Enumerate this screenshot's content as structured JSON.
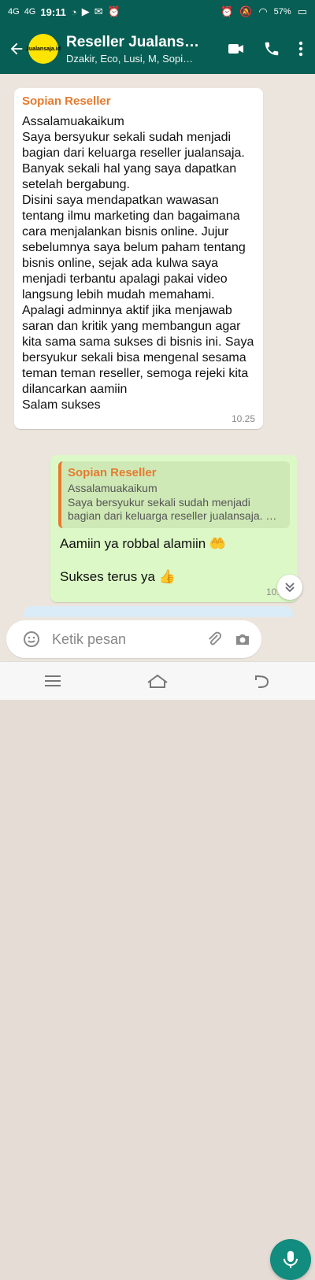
{
  "status": {
    "time": "19:11",
    "network1": "4G",
    "network2": "4G",
    "battery": "57%"
  },
  "chat": {
    "title": "Reseller Jualans…",
    "subtitle": "Dzakir, Eco, Lusi, M, Sopi…",
    "avatar_text": "Jualansaja.id"
  },
  "messages": {
    "incoming": {
      "sender": "Sopian Reseller",
      "text": "Assalamuakaikum\nSaya bersyukur sekali sudah menjadi bagian dari keluarga reseller jualansaja. Banyak sekali hal yang saya dapatkan setelah bergabung.\nDisini saya mendapatkan wawasan tentang ilmu marketing dan bagaimana cara menjalankan bisnis online. Jujur sebelumnya saya belum paham tentang bisnis online, sejak ada kulwa saya menjadi terbantu apalagi pakai video langsung lebih mudah memahami. Apalagi adminnya aktif jika menjawab saran dan kritik yang membangun agar kita sama sama sukses di bisnis ini. Saya bersyukur sekali bisa mengenal sesama teman teman reseller, semoga rejeki kita dilancarkan aamiin\nSalam sukses",
      "time": "10.25"
    },
    "outgoing": {
      "quoted_sender": "Sopian Reseller",
      "quoted_text": "Assalamuakaikum\nSaya bersyukur sekali sudah menjadi bagian dari keluarga reseller jualansaja. …",
      "line1": "Aamiin ya robbal alamiin 🤲",
      "line2": "Sukses terus ya 👍",
      "time": "10.26"
    }
  },
  "composer": {
    "placeholder": "Ketik pesan"
  },
  "colors": {
    "header": "#075e54",
    "accent": "#128c7e",
    "sender": "#e57b2f",
    "outgoing": "#dcf8c6"
  }
}
